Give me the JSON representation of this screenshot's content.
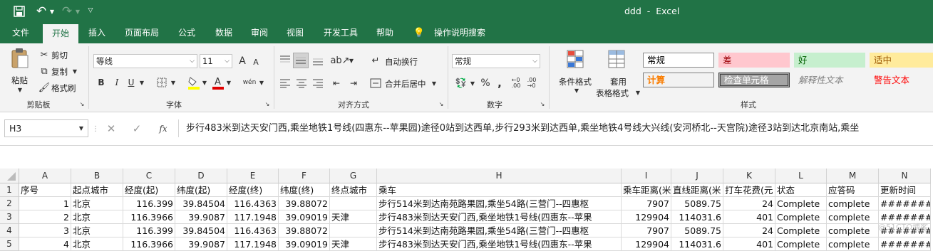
{
  "window": {
    "doc_name": "ddd",
    "app_name": "Excel",
    "separator": "-"
  },
  "tabs": [
    "文件",
    "开始",
    "插入",
    "页面布局",
    "公式",
    "数据",
    "审阅",
    "视图",
    "开发工具",
    "帮助",
    "操作说明搜索"
  ],
  "clipboard": {
    "paste": "粘贴",
    "cut": "剪切",
    "copy": "复制",
    "format_painter": "格式刷",
    "group": "剪贴板"
  },
  "font": {
    "name": "等线",
    "size": "11",
    "group": "字体",
    "bold": "B",
    "italic": "I",
    "underline": "U",
    "grow": "A",
    "shrink": "A",
    "wen": "wén"
  },
  "alignment": {
    "wrap": "自动换行",
    "merge": "合并后居中",
    "group": "对齐方式"
  },
  "number": {
    "format": "常规",
    "group": "数字",
    "percent": "%",
    "comma": ","
  },
  "styles_group": {
    "conditional": "条件格式",
    "table_format_1": "套用",
    "table_format_2": "表格格式",
    "group": "样式",
    "items": [
      {
        "label": "常规",
        "bg": "#ffffff",
        "fg": "#000000"
      },
      {
        "label": "差",
        "bg": "#ffc7ce",
        "fg": "#9c0006"
      },
      {
        "label": "好",
        "bg": "#c6efce",
        "fg": "#006100"
      },
      {
        "label": "适中",
        "bg": "#ffeb9c",
        "fg": "#9c5700"
      },
      {
        "label": "计算",
        "bg": "#f2f2f2",
        "fg": "#fa7d00"
      },
      {
        "label": "检查单元格",
        "bg": "#a5a5a5",
        "fg": "#ffffff"
      },
      {
        "label": "解释性文本",
        "bg": "#ffffff",
        "fg": "#7f7f7f"
      },
      {
        "label": "警告文本",
        "bg": "#ffffff",
        "fg": "#ff0000"
      }
    ]
  },
  "formula_bar": {
    "name_box": "H3",
    "fx": "fx",
    "content": "步行483米到达天安门西,乘坐地铁1号线(四惠东--苹果园)途径0站到达西单,步行293米到达西单,乘坐地铁4号线大兴线(安河桥北--天宫院)途径3站到达北京南站,乘坐"
  },
  "columns": [
    "A",
    "B",
    "C",
    "D",
    "E",
    "F",
    "G",
    "H",
    "I",
    "J",
    "K",
    "L",
    "M",
    "N"
  ],
  "rows": [
    [
      "序号",
      "起点城市",
      "经度(起)",
      "纬度(起)",
      "经度(终)",
      "纬度(终)",
      "终点城市",
      "乘车",
      "乘车距离(米",
      "直线距离(米",
      "打车花费(元",
      "状态",
      "应答码",
      "更新时间"
    ],
    [
      "1",
      "北京",
      "116.399",
      "39.84504",
      "116.4363",
      "39.88072",
      "",
      "步行514米到达南苑路果园,乘坐54路(三营门--四惠枢",
      "7907",
      "5089.75",
      "24",
      "Complete",
      "complete",
      "#######"
    ],
    [
      "2",
      "北京",
      "116.3966",
      "39.9087",
      "117.1948",
      "39.09019",
      "天津",
      "步行483米到达天安门西,乘坐地铁1号线(四惠东--苹果",
      "129904",
      "114031.6",
      "401",
      "Complete",
      "complete",
      "#######"
    ],
    [
      "3",
      "北京",
      "116.399",
      "39.84504",
      "116.4363",
      "39.88072",
      "",
      "步行514米到达南苑路果园,乘坐54路(三营门--四惠枢",
      "7907",
      "5089.75",
      "24",
      "Complete",
      "complete",
      "#######"
    ],
    [
      "4",
      "北京",
      "116.3966",
      "39.9087",
      "117.1948",
      "39.09019",
      "天津",
      "步行483米到达天安门西,乘坐地铁1号线(四惠东--苹果",
      "129904",
      "114031.6",
      "401",
      "Complete",
      "complete",
      "#######"
    ]
  ],
  "row_numbers": [
    "1",
    "2",
    "3",
    "4",
    "5"
  ],
  "watermark": "@51CTO博客"
}
